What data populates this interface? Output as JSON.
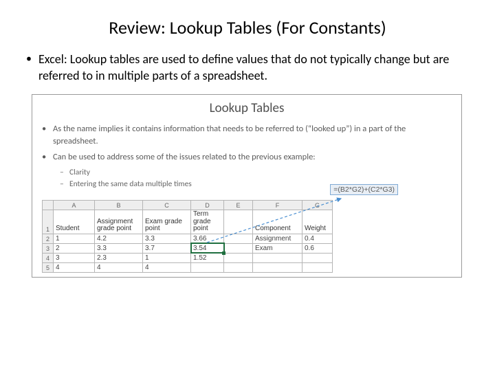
{
  "title": "Review: Lookup Tables (For Constants)",
  "body": "Excel: Lookup tables are used to define values that do not typically change but are referred to in multiple parts of a spreadsheet.",
  "inner": {
    "title": "Lookup Tables",
    "b1": "As the name implies it contains information that needs to be referred to (“looked up”) in a part of the spreadsheet.",
    "b2": "Can be used to address some of the issues related to the previous example:",
    "sub1": "Clarity",
    "sub2": "Entering the same data multiple times"
  },
  "formula": "=(B2*G2)+(C2*G3)",
  "cols": [
    "",
    "A",
    "B",
    "C",
    "D",
    "E",
    "F",
    "G"
  ],
  "headers": {
    "A": "Student",
    "B": "Assignment grade point",
    "C": "Exam grade point",
    "D": "Term grade point",
    "F": "Component",
    "G": "Weight"
  },
  "rows": [
    {
      "n": "2",
      "A": "1",
      "B": "4.2",
      "C": "3.3",
      "D": "3.66",
      "F": "Assignment",
      "G": "0.4"
    },
    {
      "n": "3",
      "A": "2",
      "B": "3.3",
      "C": "3.7",
      "D": "3.54",
      "F": "Exam",
      "G": "0.6"
    },
    {
      "n": "4",
      "A": "3",
      "B": "2.3",
      "C": "1",
      "D": "1.52",
      "F": "",
      "G": ""
    },
    {
      "n": "5",
      "A": "4",
      "B": "4",
      "C": "4",
      "D": "",
      "F": "",
      "G": ""
    }
  ]
}
